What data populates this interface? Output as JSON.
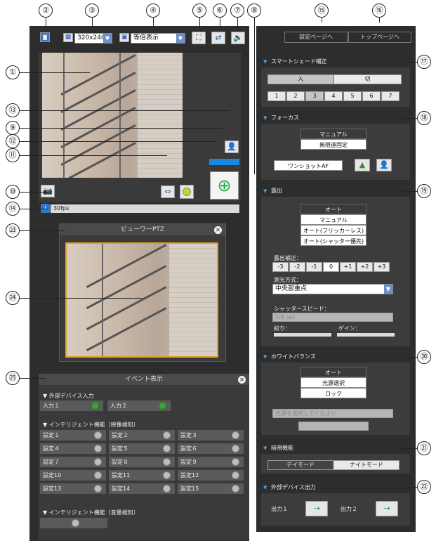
{
  "callouts": [
    "①",
    "②",
    "③",
    "④",
    "⑤",
    "⑥",
    "⑦",
    "⑧",
    "⑨",
    "⑩",
    "⑪",
    "⑫",
    "⑬",
    "⑭",
    "⑮",
    "⑯",
    "⑰",
    "⑱",
    "⑲",
    "⑳",
    "㉑",
    "㉒",
    "㉓",
    "㉔",
    "㉕"
  ],
  "toolbar": {
    "resolution": "320x240",
    "display_mode": "等倍表示",
    "res_icon": "grid-icon",
    "disp_icon": "display-icon"
  },
  "status": {
    "fps": "30fps"
  },
  "ptz": {
    "title": "ビューワーPTZ"
  },
  "event": {
    "title": "イベント表示",
    "ext_input_title": "▼ 外部デバイス入力",
    "inputs": [
      "入力１",
      "入力２"
    ],
    "video_detect_title": "▼ インテリジェント機能（映像検知）",
    "settings": [
      "設定１",
      "設定２",
      "設定３",
      "設定４",
      "設定５",
      "設定６",
      "設定７",
      "設定８",
      "設定９",
      "設定10",
      "設定11",
      "設定12",
      "設定13",
      "設定14",
      "設定15"
    ],
    "audio_detect_title": "▼ インテリジェント機能（音量検知）"
  },
  "nav": {
    "settings_page": "設定ページへ",
    "top_page": "トップページへ"
  },
  "smartshade": {
    "title": "スマートシェード補正",
    "on": "入",
    "off": "切",
    "levels": [
      "1",
      "2",
      "3",
      "4",
      "5",
      "6",
      "7"
    ]
  },
  "focus": {
    "title": "フォーカス",
    "manual": "マニュアル",
    "infinity": "無限遠固定",
    "oneshot": "ワンショットAF"
  },
  "exposure": {
    "title": "露出",
    "modes": [
      "オート",
      "マニュアル",
      "オート(フリッカーレス)",
      "オート(シャッター優先)"
    ],
    "comp_label": "露出補正：",
    "comp_values": [
      "-3",
      "-2",
      "-1",
      "0",
      "+1",
      "+2",
      "+3"
    ],
    "metering_label": "測光方式：",
    "metering_value": "中央部重点",
    "shutter_label": "シャッタースピード：",
    "shutter_value": "1/8 sec",
    "iris_label": "絞り：",
    "gain_label": "ゲイン："
  },
  "wb": {
    "title": "ホワイトバランス",
    "modes": [
      "オート",
      "光源選択",
      "ロック"
    ],
    "source_placeholder": "光源を選択してください"
  },
  "night": {
    "title": "暗視機能",
    "day": "デイモード",
    "night": "ナイトモード"
  },
  "output": {
    "title": "外部デバイス出力",
    "outputs": [
      "出力１",
      "出力２"
    ]
  }
}
